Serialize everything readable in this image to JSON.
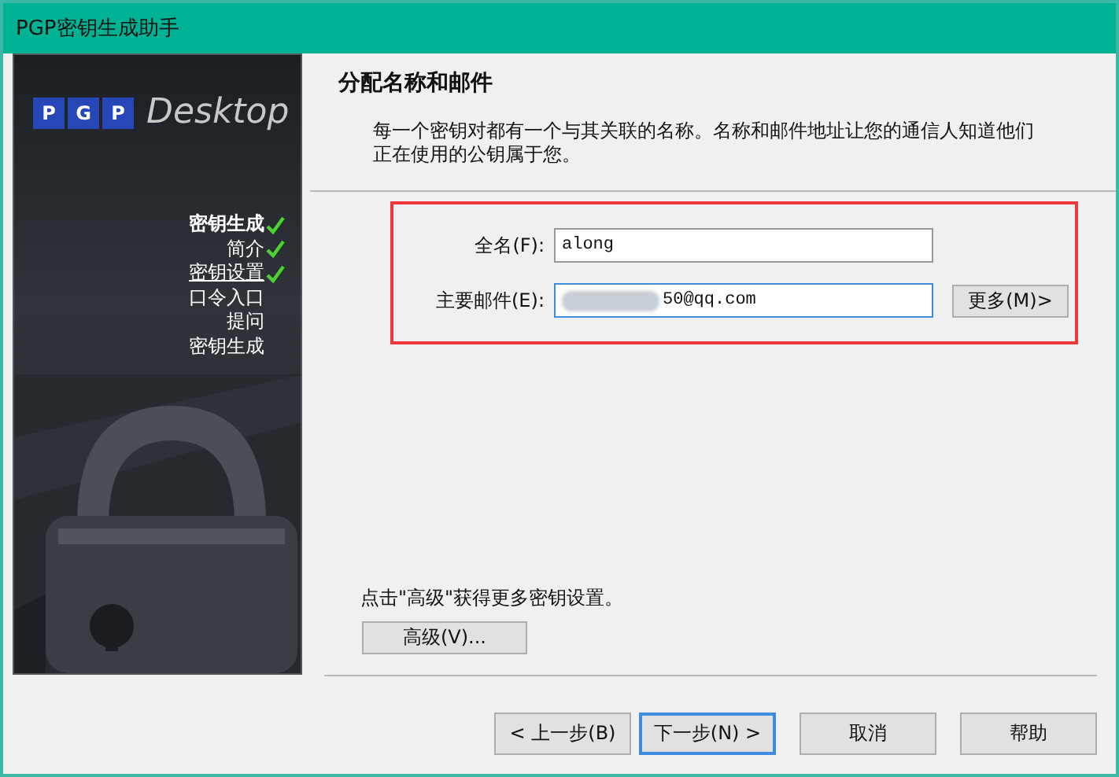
{
  "window": {
    "title": "PGP密钥生成助手"
  },
  "logo": {
    "letters": [
      "P",
      "G",
      "P"
    ],
    "word": "Desktop"
  },
  "steps": [
    {
      "label": "密钥生成",
      "kind": "heading",
      "checked": true,
      "selected": false
    },
    {
      "label": "简介",
      "kind": "step",
      "checked": true,
      "selected": false
    },
    {
      "label": "密钥设置",
      "kind": "step",
      "checked": true,
      "selected": true
    },
    {
      "label": "口令入口",
      "kind": "step",
      "checked": false,
      "selected": false
    },
    {
      "label": "提问",
      "kind": "step",
      "checked": false,
      "selected": false
    },
    {
      "label": "密钥生成",
      "kind": "step",
      "checked": false,
      "selected": false
    }
  ],
  "page": {
    "heading": "分配名称和邮件",
    "description": "每一个密钥对都有一个与其关联的名称。名称和邮件地址让您的通信人知道他们正在使用的公钥属于您。"
  },
  "fields": [
    {
      "label": "全名(F):",
      "value": "along",
      "focused": false,
      "redacted": false
    },
    {
      "label": "主要邮件(E):",
      "value": "50@qq.com",
      "focused": true,
      "redacted": true
    }
  ],
  "more_button": "更多(M)>",
  "advanced": {
    "hint": "点击\"高级\"获得更多密钥设置。",
    "button": "高级(V)..."
  },
  "buttons": [
    {
      "label": "< 上一步(B)",
      "default": false
    },
    {
      "label": "下一步(N) >",
      "default": true
    },
    {
      "label": "取消",
      "default": false
    },
    {
      "label": "帮助",
      "default": false
    }
  ]
}
